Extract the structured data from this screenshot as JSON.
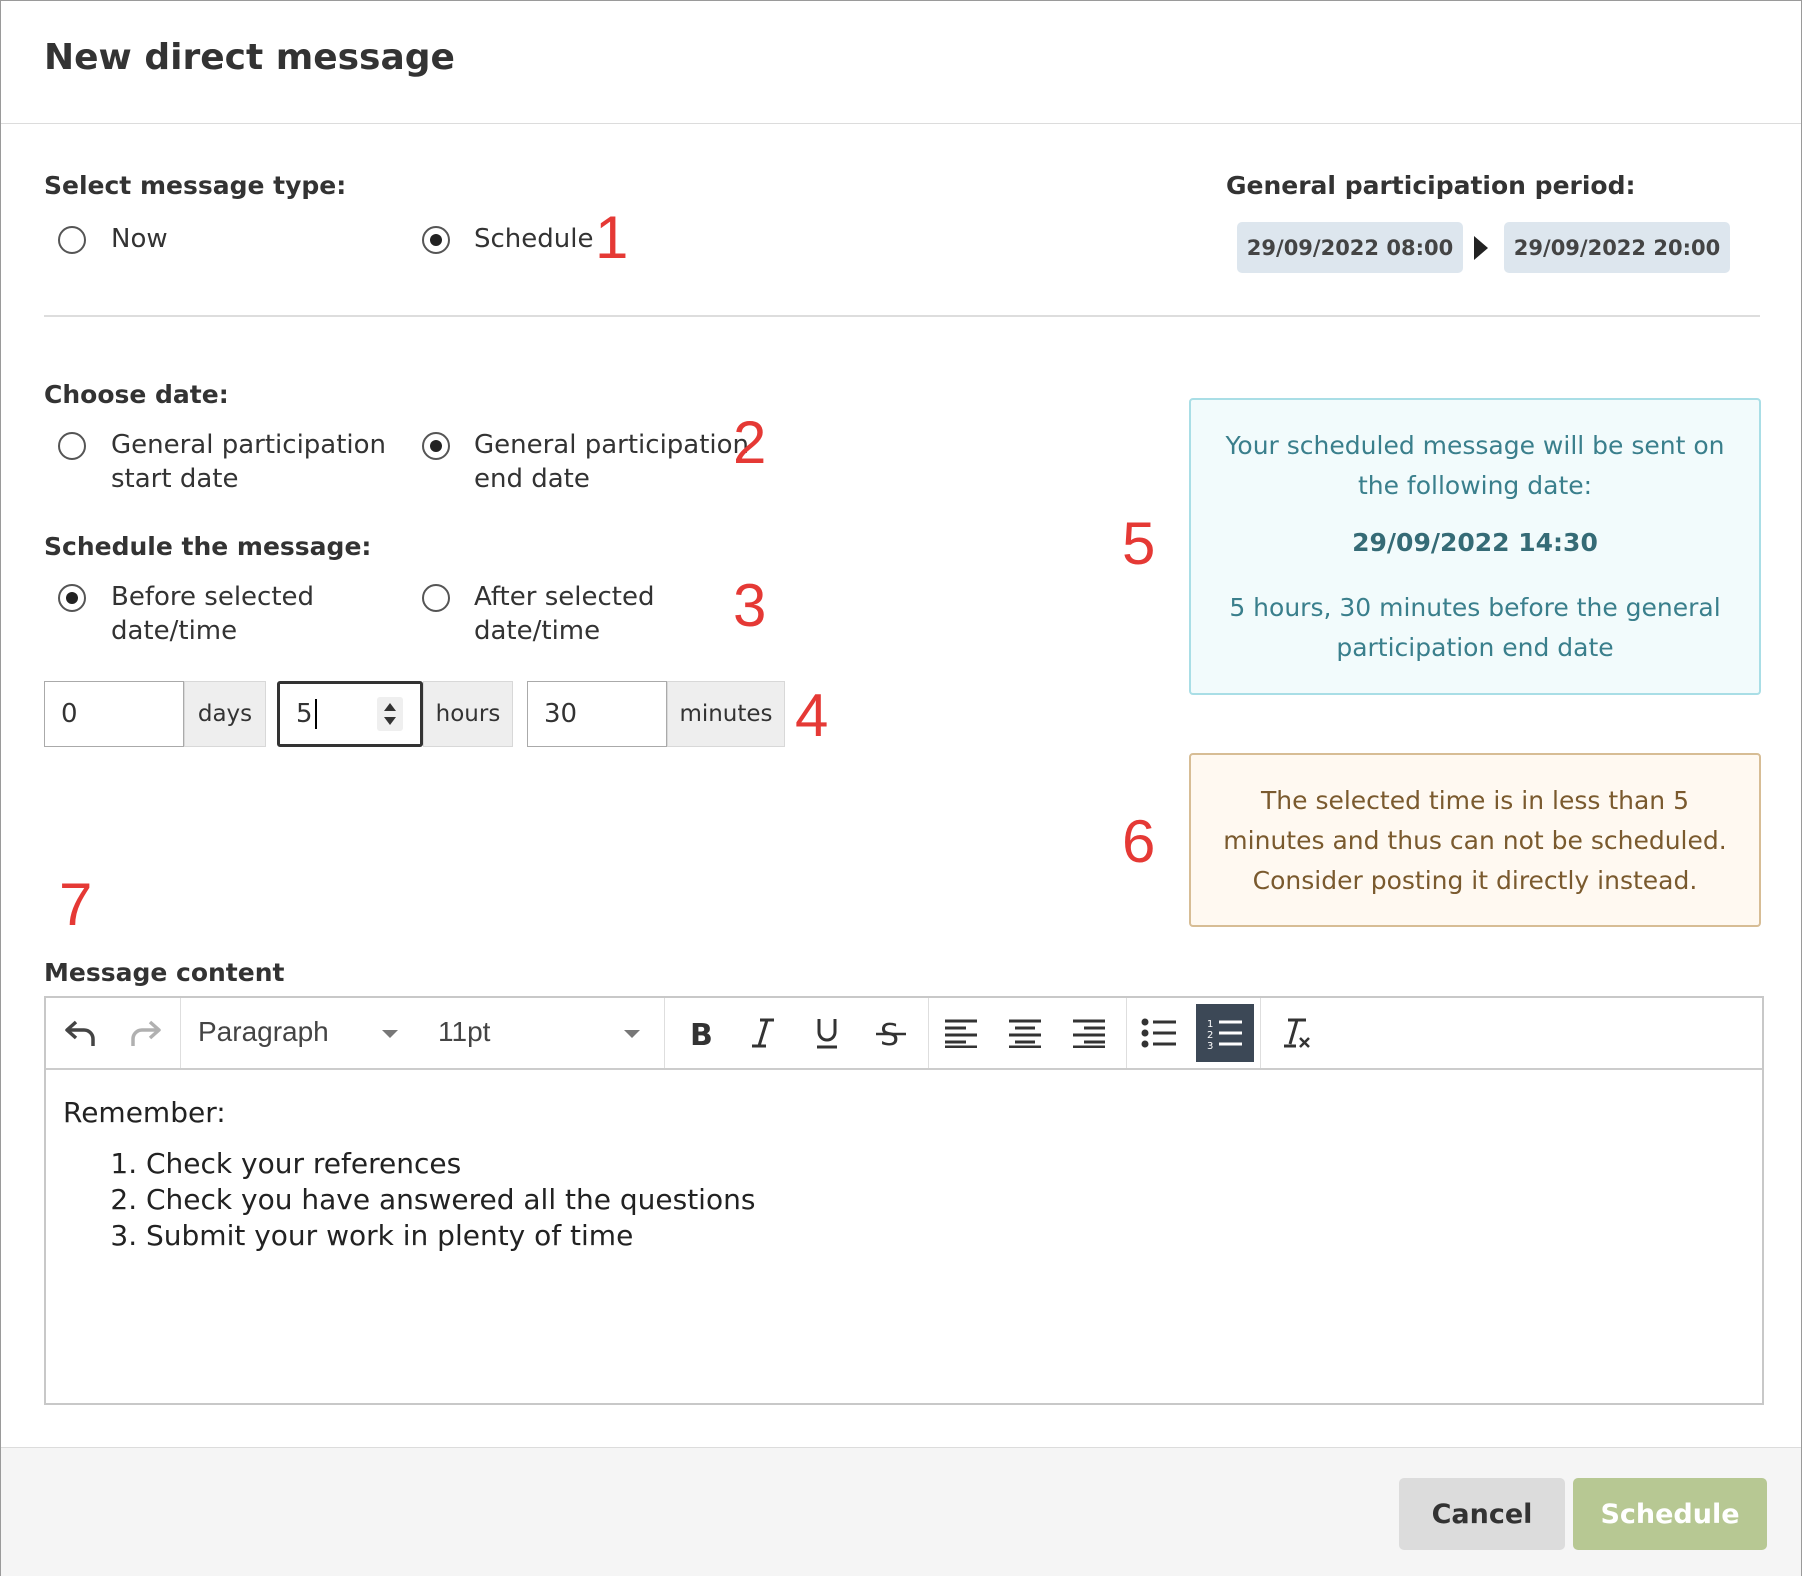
{
  "dialog": {
    "title": "New direct message"
  },
  "message_type": {
    "label": "Select message type:",
    "options": [
      {
        "label": "Now",
        "checked": false
      },
      {
        "label": "Schedule",
        "checked": true
      }
    ]
  },
  "participation_period": {
    "label": "General participation period:",
    "start": "29/09/2022 08:00",
    "end": "29/09/2022 20:00"
  },
  "choose_date": {
    "label": "Choose date:",
    "options": [
      {
        "line1": "General participation",
        "line2": "start date",
        "checked": false
      },
      {
        "line1": "General participation",
        "line2": "end date",
        "checked": true
      }
    ]
  },
  "schedule_relative": {
    "label": "Schedule the message:",
    "options": [
      {
        "line1": "Before selected",
        "line2": "date/time",
        "checked": true
      },
      {
        "line1": "After selected",
        "line2": "date/time",
        "checked": false
      }
    ]
  },
  "offset": {
    "days": {
      "value": "0",
      "unit": "days"
    },
    "hours": {
      "value": "5",
      "unit": "hours"
    },
    "minutes": {
      "value": "30",
      "unit": "minutes"
    }
  },
  "info_box": {
    "line1": "Your scheduled message will be sent on the following date:",
    "date": "29/09/2022 14:30",
    "line3": "5 hours, 30 minutes before the general participation end date"
  },
  "warning_box": {
    "text": "The selected time is in less than 5 minutes and thus can not be scheduled. Consider posting it directly instead."
  },
  "annotations": [
    "1",
    "2",
    "3",
    "4",
    "5",
    "6",
    "7"
  ],
  "editor": {
    "label": "Message content",
    "block_format": "Paragraph",
    "font_size": "11pt",
    "toolbar_icons": [
      "undo-icon",
      "redo-icon",
      "bold-icon",
      "italic-icon",
      "underline-icon",
      "strikethrough-icon",
      "align-left-icon",
      "align-center-icon",
      "align-right-icon",
      "bullet-list-icon",
      "numbered-list-icon",
      "clear-formatting-icon"
    ],
    "intro": "Remember:",
    "list": [
      "Check your references",
      "Check you have answered all the questions",
      "Submit your work in plenty of time"
    ]
  },
  "footer": {
    "cancel_label": "Cancel",
    "schedule_label": "Schedule"
  },
  "colors": {
    "schedule_button": "#b7c893",
    "info_text": "#3a7f8c",
    "warning_text": "#7a5a2e",
    "annotation": "#e53935",
    "active_tool": "#3c4856"
  }
}
